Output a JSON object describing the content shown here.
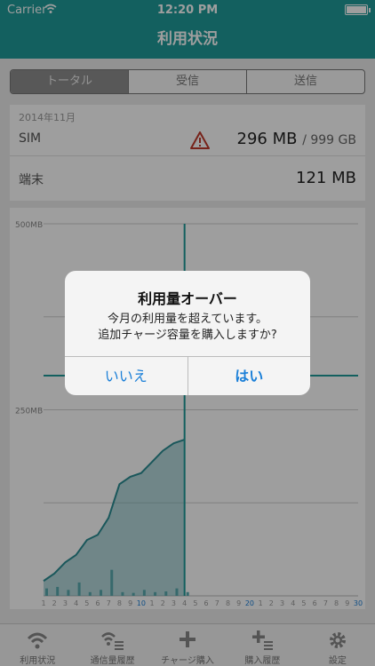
{
  "status_bar": {
    "carrier": "Carrier",
    "time": "12:20 PM"
  },
  "nav": {
    "title": "利用状況"
  },
  "segments": [
    "トータル",
    "受信",
    "送信"
  ],
  "usage": {
    "month": "2014年11月",
    "sim_label": "SIM",
    "sim_value": "296 MB",
    "sim_total": "/ 999 GB",
    "device_label": "端末",
    "device_value": "121 MB"
  },
  "chart_data": {
    "type": "area",
    "ylabels": [
      "500MB",
      "250MB"
    ],
    "ylim": [
      0,
      500
    ],
    "x": [
      "1",
      "2",
      "3",
      "4",
      "5",
      "6",
      "7",
      "8",
      "9",
      "10",
      "1",
      "2",
      "3",
      "4",
      "5",
      "6",
      "7",
      "8",
      "9",
      "20",
      "1",
      "2",
      "3",
      "4",
      "5",
      "6",
      "7",
      "8",
      "9",
      "30"
    ],
    "highlight_ticks": [
      "10",
      "20",
      "30"
    ],
    "cumulative": [
      20,
      30,
      45,
      55,
      75,
      82,
      105,
      150,
      160,
      165,
      180,
      195,
      205,
      210
    ],
    "daily": [
      10,
      12,
      8,
      18,
      5,
      8,
      35,
      5,
      4,
      8,
      5,
      6,
      10,
      5
    ],
    "current_day": 14,
    "limit_line_mb": 296
  },
  "dialog": {
    "title": "利用量オーバー",
    "message_line1": "今月の利用量を超えています。",
    "message_line2": "追加チャージ容量を購入しますか?",
    "no_label": "いいえ",
    "yes_label": "はい"
  },
  "tabs": [
    {
      "label": "利用状況",
      "icon": "wifi-icon"
    },
    {
      "label": "通信量履歴",
      "icon": "wifi-list-icon"
    },
    {
      "label": "チャージ購入",
      "icon": "plus-icon"
    },
    {
      "label": "購入履歴",
      "icon": "plus-list-icon"
    },
    {
      "label": "設定",
      "icon": "gear-icon"
    }
  ],
  "colors": {
    "accent": "#1f9c9a",
    "chart_fill": "#5aaab0",
    "link": "#1a7fd8",
    "warning": "#c0392b"
  }
}
